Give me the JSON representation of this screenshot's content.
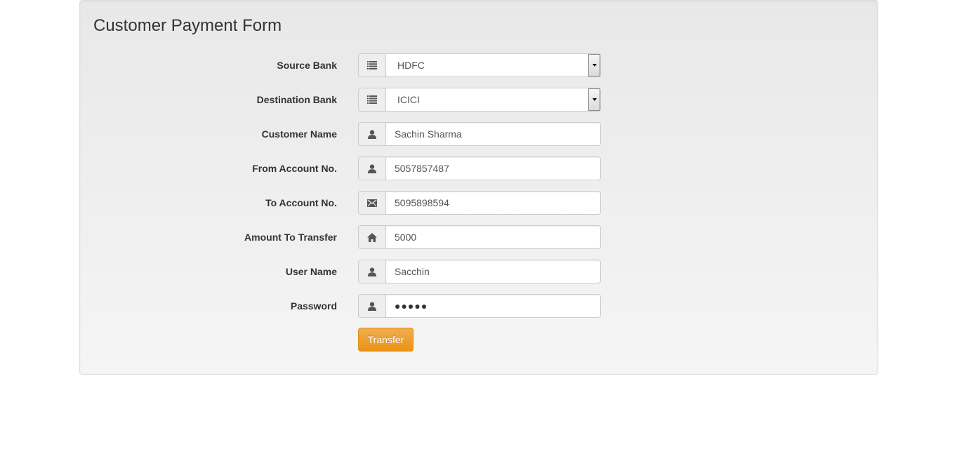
{
  "form": {
    "title": "Customer Payment Form",
    "source_bank": {
      "label": "Source Bank",
      "value": "HDFC",
      "icon": "list-icon"
    },
    "destination_bank": {
      "label": "Destination Bank",
      "value": "ICICI",
      "icon": "list-icon"
    },
    "customer_name": {
      "label": "Customer Name",
      "value": "Sachin Sharma",
      "icon": "user-icon"
    },
    "from_account": {
      "label": "From Account No.",
      "value": "5057857487",
      "icon": "user-icon"
    },
    "to_account": {
      "label": "To Account No.",
      "value": "5095898594",
      "icon": "envelope-icon"
    },
    "amount": {
      "label": "Amount To Transfer",
      "value": "5000",
      "icon": "home-icon"
    },
    "user_name": {
      "label": "User Name",
      "value": "Sacchin",
      "icon": "user-icon"
    },
    "password": {
      "label": "Password",
      "value": "●●●●●",
      "icon": "user-icon"
    },
    "submit_label": "Transfer"
  },
  "colors": {
    "button_accent": "#f0ad4e",
    "panel_bg": "#eeeeee"
  }
}
